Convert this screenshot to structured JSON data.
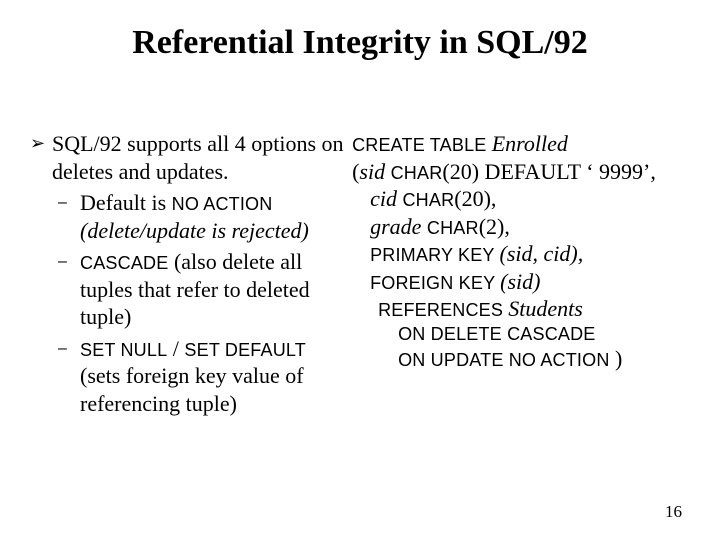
{
  "title": "Referential Integrity in SQL/92",
  "left": {
    "intro": "SQL/92 supports all 4 options on deletes and updates.",
    "b1_pre": "Default is ",
    "b1_kw": "NO ACTION",
    "b1_post": " (delete/update is rejected)",
    "b2_kw": "CASCADE",
    "b2_post": "  (also delete all tuples that refer to deleted tuple)",
    "b3_kw1": "SET NULL",
    "b3_sep": " / ",
    "b3_kw2": "SET DEFAULT",
    "b3_post": " (sets foreign key value of referencing tuple)"
  },
  "right": {
    "l1_kw": "CREATE TABLE ",
    "l1_it": "Enrolled",
    "l2_pre": "   (",
    "l2_it": "sid ",
    "l2_kw": "CHAR",
    "l2_post": "(20) DEFAULT ‘ 9999’,",
    "l3_it": "cid ",
    "l3_kw": "CHAR",
    "l3_post": "(20),",
    "l4_it": "grade ",
    "l4_kw": "CHAR",
    "l4_post": "(2),",
    "l5_kw": "PRIMARY KEY  ",
    "l5_post": "(sid, cid),",
    "l6_kw": "FOREIGN KEY ",
    "l6_post": "(sid)",
    "l7_kw": "REFERENCES ",
    "l7_it": "Students",
    "l8": "ON DELETE CASCADE",
    "l9_a": "ON UPDATE NO ACTION",
    "l9_b": " )"
  },
  "pagenum": "16",
  "chart_data": {
    "type": "table",
    "title": "Referential Integrity in SQL/92",
    "options": [
      "NO ACTION (default; delete/update rejected)",
      "CASCADE (delete referencing tuples)",
      "SET NULL",
      "SET DEFAULT"
    ],
    "ddl": "CREATE TABLE Enrolled (sid CHAR(20) DEFAULT '9999', cid CHAR(20), grade CHAR(2), PRIMARY KEY (sid, cid), FOREIGN KEY (sid) REFERENCES Students ON DELETE CASCADE ON UPDATE NO ACTION)"
  }
}
